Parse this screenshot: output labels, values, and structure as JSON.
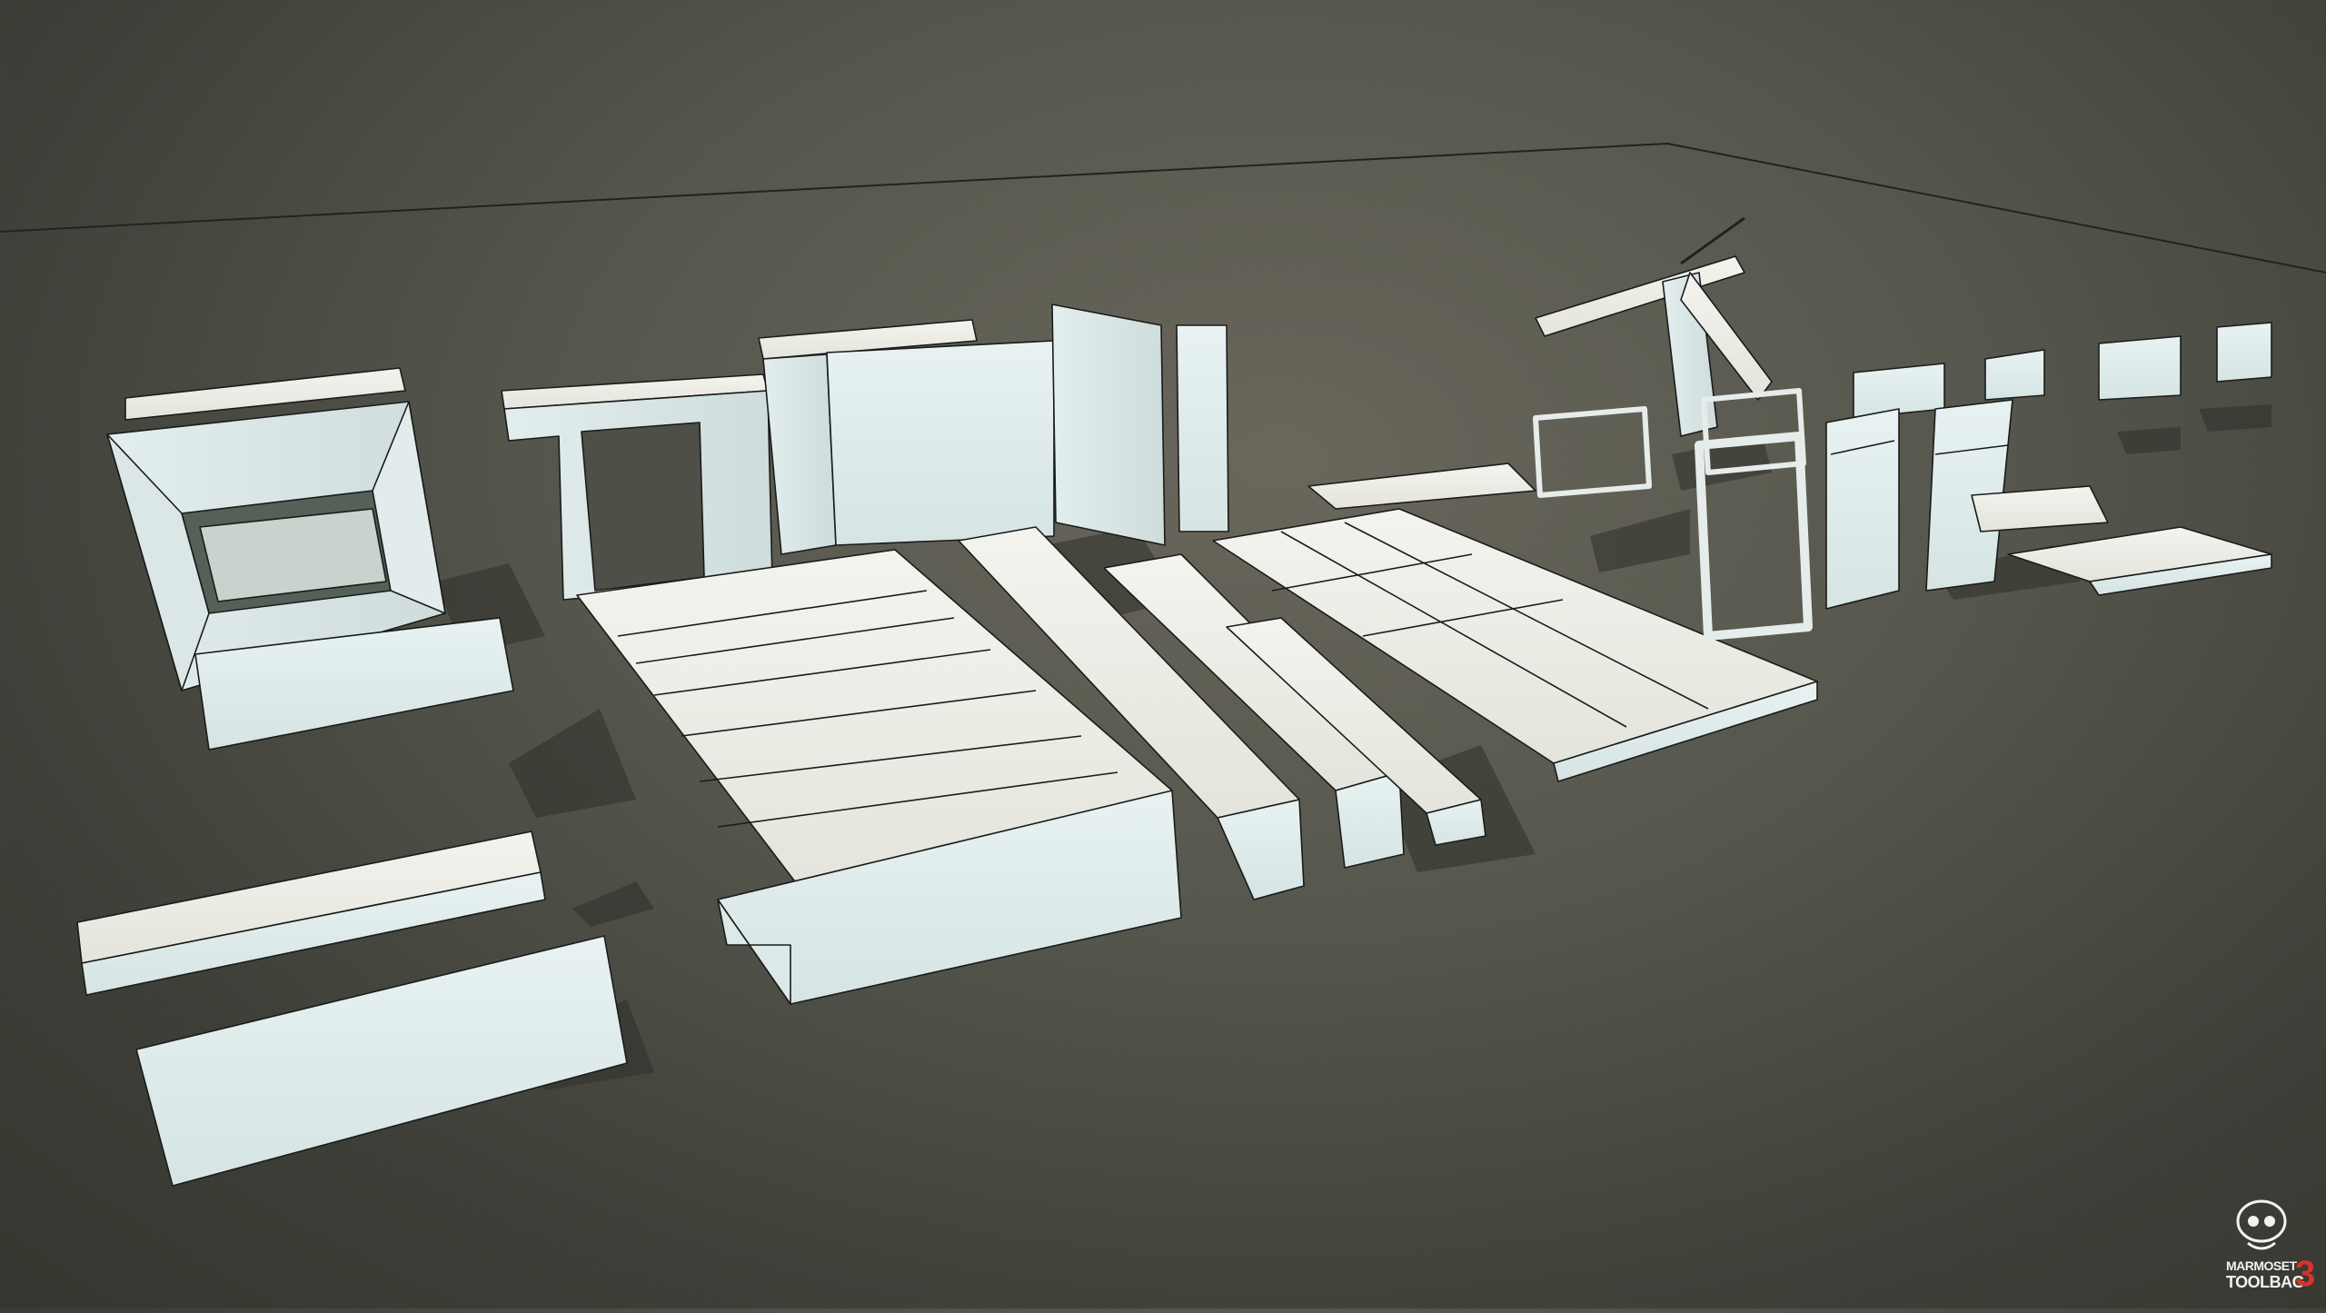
{
  "watermark": {
    "line1": "MARMOSET",
    "line2": "TOOLBAG",
    "version": "3",
    "logo_icon": "marmoset-skull-icon",
    "version_color": "#d8322a"
  },
  "scene": {
    "background_color": "#55564c",
    "mesh_color": "#eef0ea",
    "wire_color": "#1b1b1b",
    "shadow_color": "#2b2c26"
  }
}
